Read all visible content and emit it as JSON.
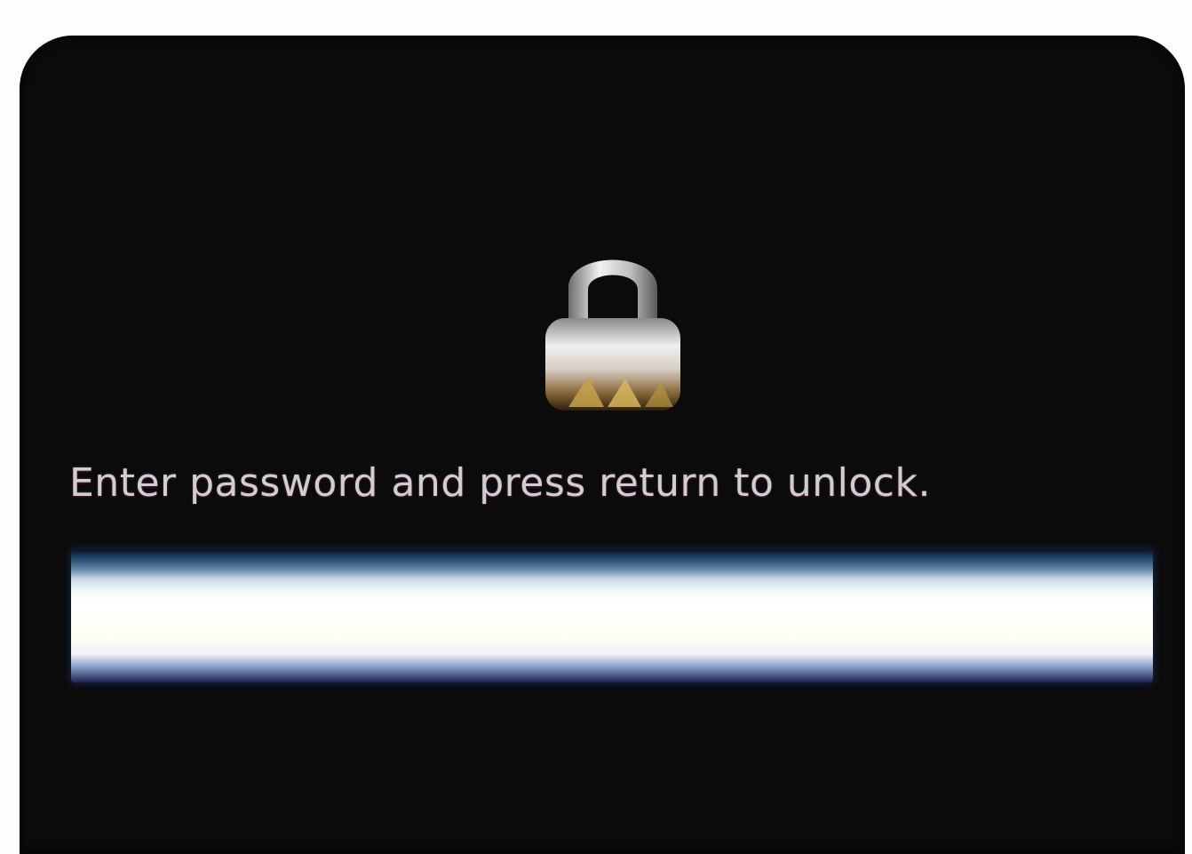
{
  "lock_screen": {
    "icon": "padlock-icon",
    "prompt": "Enter password and press return to unlock.",
    "password": {
      "value": "",
      "placeholder": ""
    }
  },
  "colors": {
    "background": "#0b0b0b",
    "prompt_text": "#cfcfcf",
    "field_glow": "#20466a"
  }
}
